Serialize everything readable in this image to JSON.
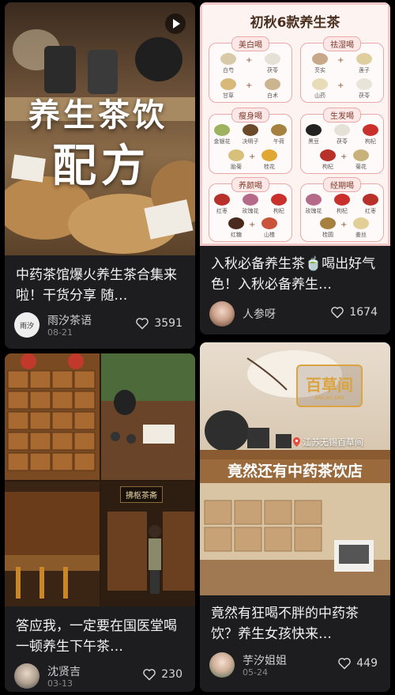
{
  "cards": [
    {
      "title": "中药茶馆爆火养生茶合集来啦！干货分享 随…",
      "cover_text": [
        "养生茶饮",
        "配方"
      ],
      "author": "雨汐茶语",
      "avatar_text": "雨汐",
      "date": "08-21",
      "likes": "3591",
      "has_play_icon": true
    },
    {
      "title": "入秋必备养生茶🍵喝出好气色！入秋必备养生…",
      "author": "人参呀",
      "date": "",
      "likes": "1674",
      "infographic": {
        "title": "初秋6款养生茶",
        "panels": [
          {
            "name": "美白喝",
            "items": [
              "白芍",
              "茯苓",
              "甘草",
              "白术"
            ]
          },
          {
            "name": "祛湿喝",
            "items": [
              "芡实",
              "莲子",
              "山药",
              "茯苓"
            ]
          },
          {
            "name": "瘦身喝",
            "items": [
              "金银花",
              "决明子",
              "午荷",
              "胎菊",
              "桂花",
              ""
            ]
          },
          {
            "name": "生发喝",
            "items": [
              "黑豆",
              "茯苓",
              "枸杞",
              "枸杞",
              "菊花",
              ""
            ]
          },
          {
            "name": "养颜喝",
            "items": [
              "红枣",
              "玫瑰花",
              "枸杞",
              "红糖",
              "山楂",
              ""
            ]
          },
          {
            "name": "经期喝",
            "items": [
              "玫瑰花",
              "枸杞",
              "红枣",
              "桂圆",
              "姜丝",
              ""
            ]
          }
        ]
      }
    },
    {
      "title": "答应我，一定要在国医堂喝一顿养生下午茶…",
      "author": "沈贤吉",
      "date": "03-13",
      "likes": "230",
      "sign_text": "拂枢茶斋"
    },
    {
      "title": "竟然有狂喝不胖的中药茶饮？养生女孩快来…",
      "author": "芋汐姐姐",
      "date": "05-24",
      "likes": "449",
      "logo_text": "百草间",
      "logo_sub": "BAICAO JIAN",
      "location": "江苏无锡百草间",
      "banner": "竟然还有中药茶饮店"
    }
  ],
  "colors": {
    "background": "#000000",
    "card": "#1d1d1f",
    "text": "#f2f2f2",
    "muted": "#888888",
    "infographic_border": "#e9a9a9"
  }
}
